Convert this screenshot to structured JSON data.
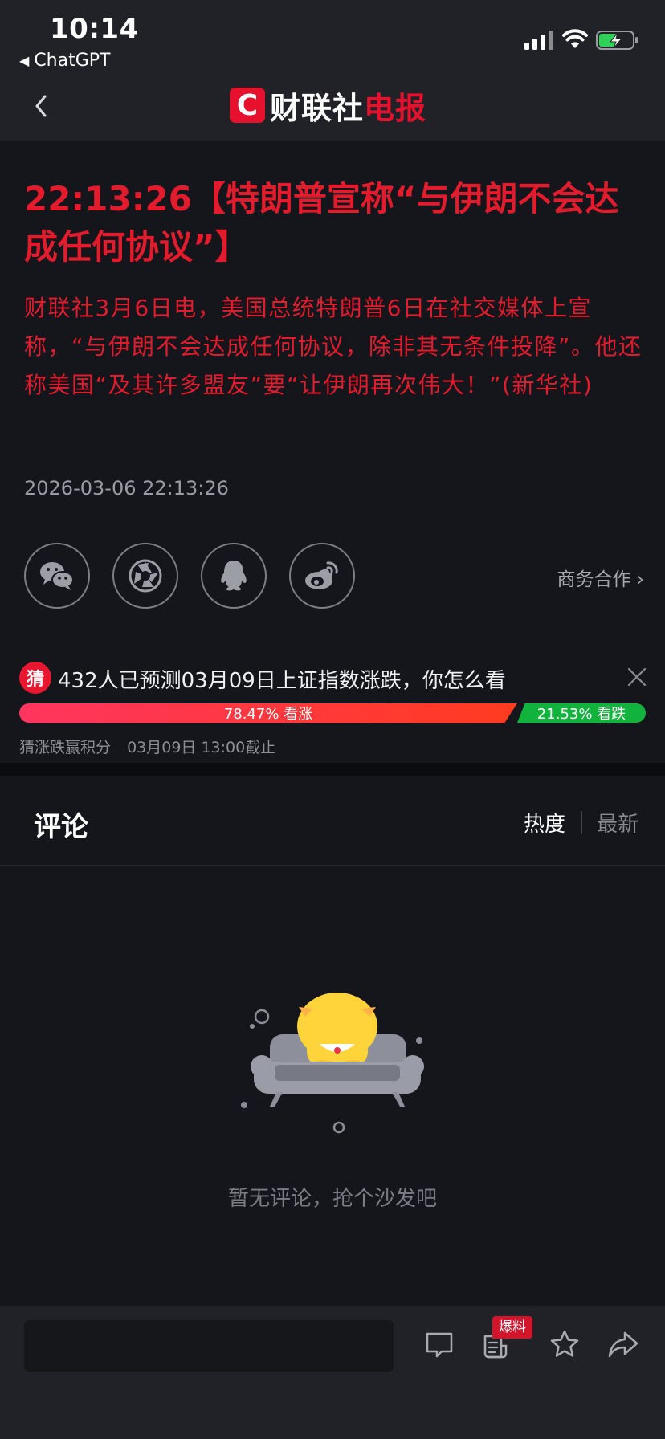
{
  "status_bar": {
    "time": "10:14",
    "back_app": "ChatGPT"
  },
  "nav": {
    "logo_letter": "C",
    "logo_text_white": "财联社",
    "logo_text_red": "电报"
  },
  "article": {
    "headline": "22:13:26【特朗普宣称“与伊朗不会达成任何协议”】",
    "body": "财联社3月6日电，美国总统特朗普6日在社交媒体上宣称，“与伊朗不会达成任何协议，除非其无条件投降”。他还称美国“及其许多盟友”要“让伊朗再次伟大！”(新华社)",
    "datetime": "2026-03-06 22:13:26"
  },
  "share": {
    "icons": [
      "wechat-icon",
      "moments-icon",
      "qq-icon",
      "weibo-icon"
    ],
    "business": "商务合作 ›"
  },
  "prediction": {
    "badge": "猜",
    "title": "432人已预测03月09日上证指数涨跌，你怎么看",
    "up_label": "78.47% 看涨",
    "down_label": "21.53% 看跌",
    "up_percent": 78.47,
    "down_percent": 21.53,
    "footer_left": "猜涨跌赢积分",
    "footer_right": "03月09日 13:00截止"
  },
  "comments": {
    "title": "评论",
    "sort_hot": "热度",
    "sort_new": "最新",
    "empty_text": "暂无评论，抢个沙发吧"
  },
  "bottom_bar": {
    "input_placeholder": "",
    "scoop_tag": "爆料"
  },
  "colors": {
    "accent_red": "#e21b2d",
    "up_red": "#ff355e",
    "down_green": "#12b33c",
    "background": "#14161c"
  }
}
